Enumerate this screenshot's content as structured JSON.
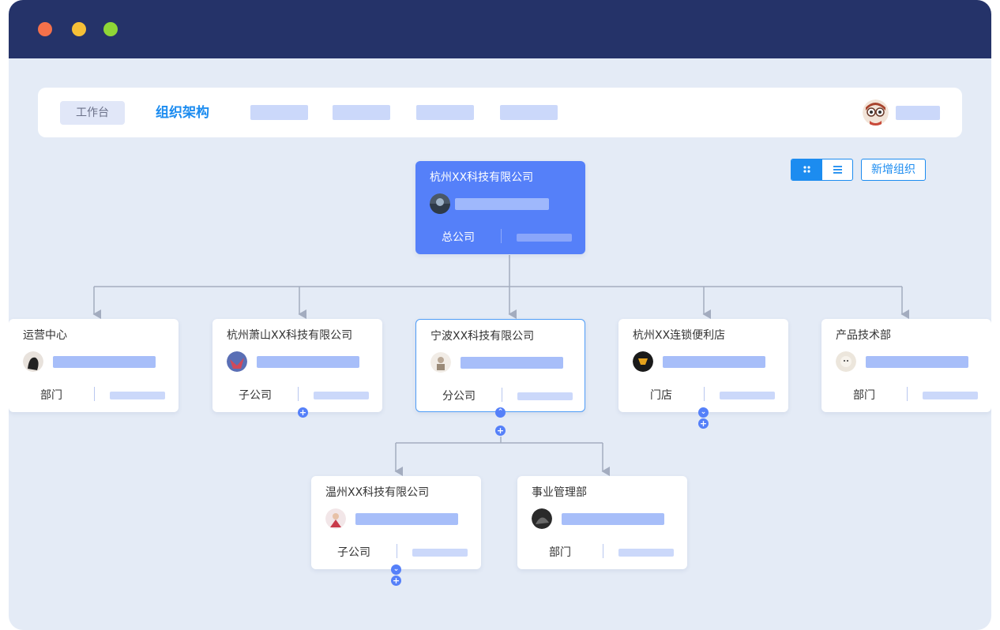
{
  "window": {
    "controls": [
      {
        "name": "close",
        "color": "#f5714a"
      },
      {
        "name": "minimize",
        "color": "#f6c037"
      },
      {
        "name": "maximize",
        "color": "#8fd636"
      }
    ]
  },
  "nav": {
    "workbench_label": "工作台",
    "active_label": "组织架构",
    "user_avatar_icon": "user-avatar-icon"
  },
  "toolbar": {
    "grid_view_icon": "grid-view-icon",
    "list_view_icon": "list-view-icon",
    "add_org_label": "新增组织"
  },
  "org": {
    "root": {
      "title": "杭州XX科技有限公司",
      "type": "总公司"
    },
    "level1": [
      {
        "title": "运营中心",
        "type": "部门"
      },
      {
        "title": "杭州萧山XX科技有限公司",
        "type": "子公司"
      },
      {
        "title": "宁波XX科技有限公司",
        "type": "分公司"
      },
      {
        "title": "杭州XX连锁便利店",
        "type": "门店"
      },
      {
        "title": "产品技术部",
        "type": "部门"
      }
    ],
    "level2": [
      {
        "title": "温州XX科技有限公司",
        "type": "子公司"
      },
      {
        "title": "事业管理部",
        "type": "部门"
      }
    ]
  },
  "colors": {
    "accent": "#1c8cf0",
    "root_card": "#5580f9",
    "titlebar": "#253369",
    "canvas": "#e4ebf6"
  }
}
